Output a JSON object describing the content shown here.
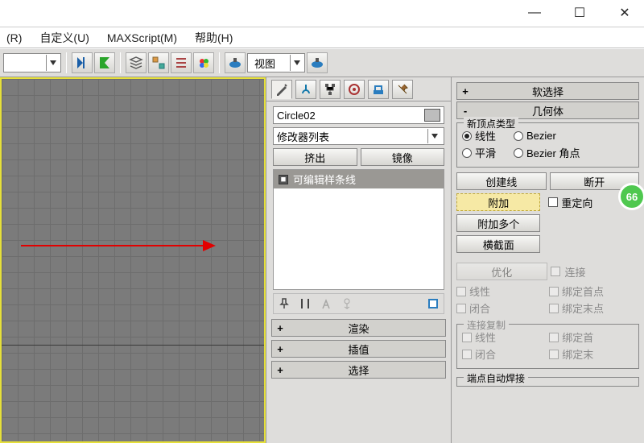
{
  "window": {
    "min": "—",
    "max": "☐",
    "close": "✕"
  },
  "menu": {
    "render": "(R)",
    "custom": "自定义(U)",
    "maxscript": "MAXScript(M)",
    "help": "帮助(H)"
  },
  "toolbar": {
    "layer_combo": "",
    "view_combo": "视图"
  },
  "badge": "66",
  "cmd": {
    "object_name": "Circle02",
    "modlist": "修改器列表",
    "btn_extrude": "挤出",
    "btn_mirror": "镜像",
    "stack_item": "可编辑样条线",
    "rollouts": {
      "render": "渲染",
      "interp": "插值",
      "select": "选择"
    }
  },
  "right": {
    "soft_sel": "软选择",
    "geometry": "几何体",
    "vertex_type": {
      "title": "新顶点类型",
      "linear": "线性",
      "bezier": "Bezier",
      "smooth": "平滑",
      "bezier_corner": "Bezier 角点"
    },
    "create_line": "创建线",
    "break": "断开",
    "attach": "附加",
    "reorient": "重定向",
    "attach_many": "附加多个",
    "cross_sec": "横截面",
    "optimize": "优化",
    "connect": "连接",
    "linear2": "线性",
    "bind_first": "绑定首点",
    "close": "闭合",
    "bind_last": "绑定末点",
    "connect_copy": "连接复制",
    "linear3": "线性",
    "bind_first2": "绑定首",
    "close2": "闭合",
    "bind_last2": "绑定末",
    "auto_weld_title": "端点自动焊接"
  }
}
